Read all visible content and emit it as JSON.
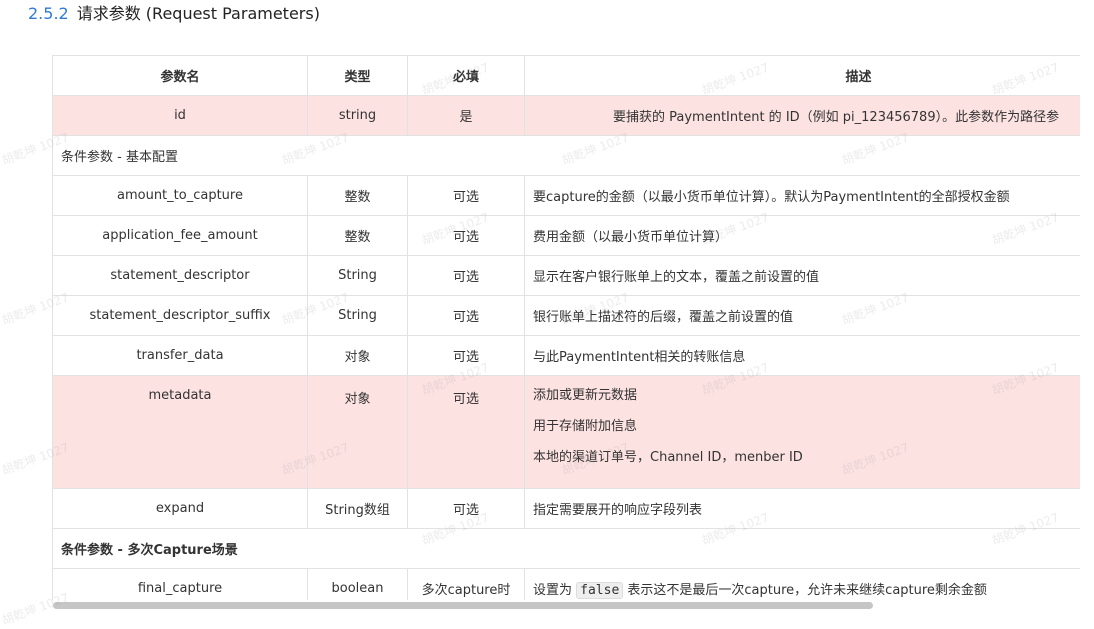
{
  "heading": {
    "number": "2.5.2",
    "title": "请求参数 (Request Parameters)"
  },
  "table": {
    "headers": [
      "参数名",
      "类型",
      "必填",
      "描述"
    ],
    "id_row": {
      "name": "id",
      "type": "string",
      "required": "是",
      "desc": "要捕获的 PaymentIntent 的 ID（例如 pi_123456789）。此参数作为路径参"
    },
    "group1": "条件参数 - 基本配置",
    "rows": [
      {
        "name": "amount_to_capture",
        "type": "整数",
        "required": "可选",
        "desc": "要capture的金额（以最小货币单位计算）。默认为PaymentIntent的全部授权金额"
      },
      {
        "name": "application_fee_amount",
        "type": "整数",
        "required": "可选",
        "desc": "费用金额（以最小货币单位计算）"
      },
      {
        "name": "statement_descriptor",
        "type": "String",
        "required": "可选",
        "desc": "显示在客户银行账单上的文本，覆盖之前设置的值"
      },
      {
        "name": "statement_descriptor_suffix",
        "type": "String",
        "required": "可选",
        "desc": "银行账单上描述符的后缀，覆盖之前设置的值"
      },
      {
        "name": "transfer_data",
        "type": "对象",
        "required": "可选",
        "desc": "与此PaymentIntent相关的转账信息"
      }
    ],
    "metadata_row": {
      "name": "metadata",
      "type": "对象",
      "required": "可选",
      "lines": [
        "添加或更新元数据",
        "用于存储附加信息",
        "本地的渠道订单号，Channel ID，menber ID"
      ]
    },
    "expand_row": {
      "name": "expand",
      "type": "String数组",
      "required": "可选",
      "desc": "指定需要展开的响应字段列表"
    },
    "group2": "条件参数 - 多次Capture场景",
    "final_row": {
      "name": "final_capture",
      "type": "boolean",
      "required": "多次capture时",
      "desc_pre": "设置为 ",
      "desc_code": "false",
      "desc_post": " 表示这不是最后一次capture，允许未来继续capture剩余金额"
    }
  },
  "watermark": "胡乾坤 1027"
}
